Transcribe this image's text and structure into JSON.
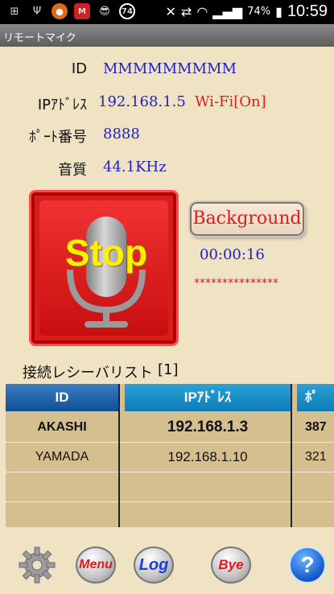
{
  "status_bar": {
    "battery_percent": "74%",
    "time": "10:59",
    "badge_number": "74"
  },
  "app": {
    "title": "リモートマイク"
  },
  "info": {
    "id_label": "ID",
    "id_value": "MMMMMMMMM",
    "ip_label": "IPｱﾄﾞﾚｽ",
    "ip_value": "192.168.1.5",
    "wifi_status": "Wi-Fi[On]",
    "port_label": "ﾎﾟｰﾄ番号",
    "port_value": "8888",
    "quality_label": "音質",
    "quality_value": "44.1KHz"
  },
  "controls": {
    "stop_label": "Stop",
    "background_label": "Background",
    "elapsed": "00:00:16",
    "level_meter": "***************"
  },
  "receiver_list": {
    "title": "接続レシーバリスト",
    "count": "[1]",
    "columns": [
      "ID",
      "IPｱﾄﾞﾚｽ",
      "ﾎﾟ"
    ],
    "rows": [
      [
        "AKASHI",
        "192.168.1.3",
        "387"
      ],
      [
        "YAMADA",
        "192.168.1.10",
        "321"
      ],
      [
        "",
        "",
        ""
      ],
      [
        "",
        "",
        ""
      ]
    ]
  },
  "toolbar": {
    "menu_label": "Menu",
    "log_label": "Log",
    "bye_label": "Bye",
    "help_label": "?"
  },
  "colors": {
    "background": "#efe3c4",
    "value_blue": "#2020c8",
    "accent_red": "#e21a1a",
    "stop_yellow": "#ffef00"
  }
}
